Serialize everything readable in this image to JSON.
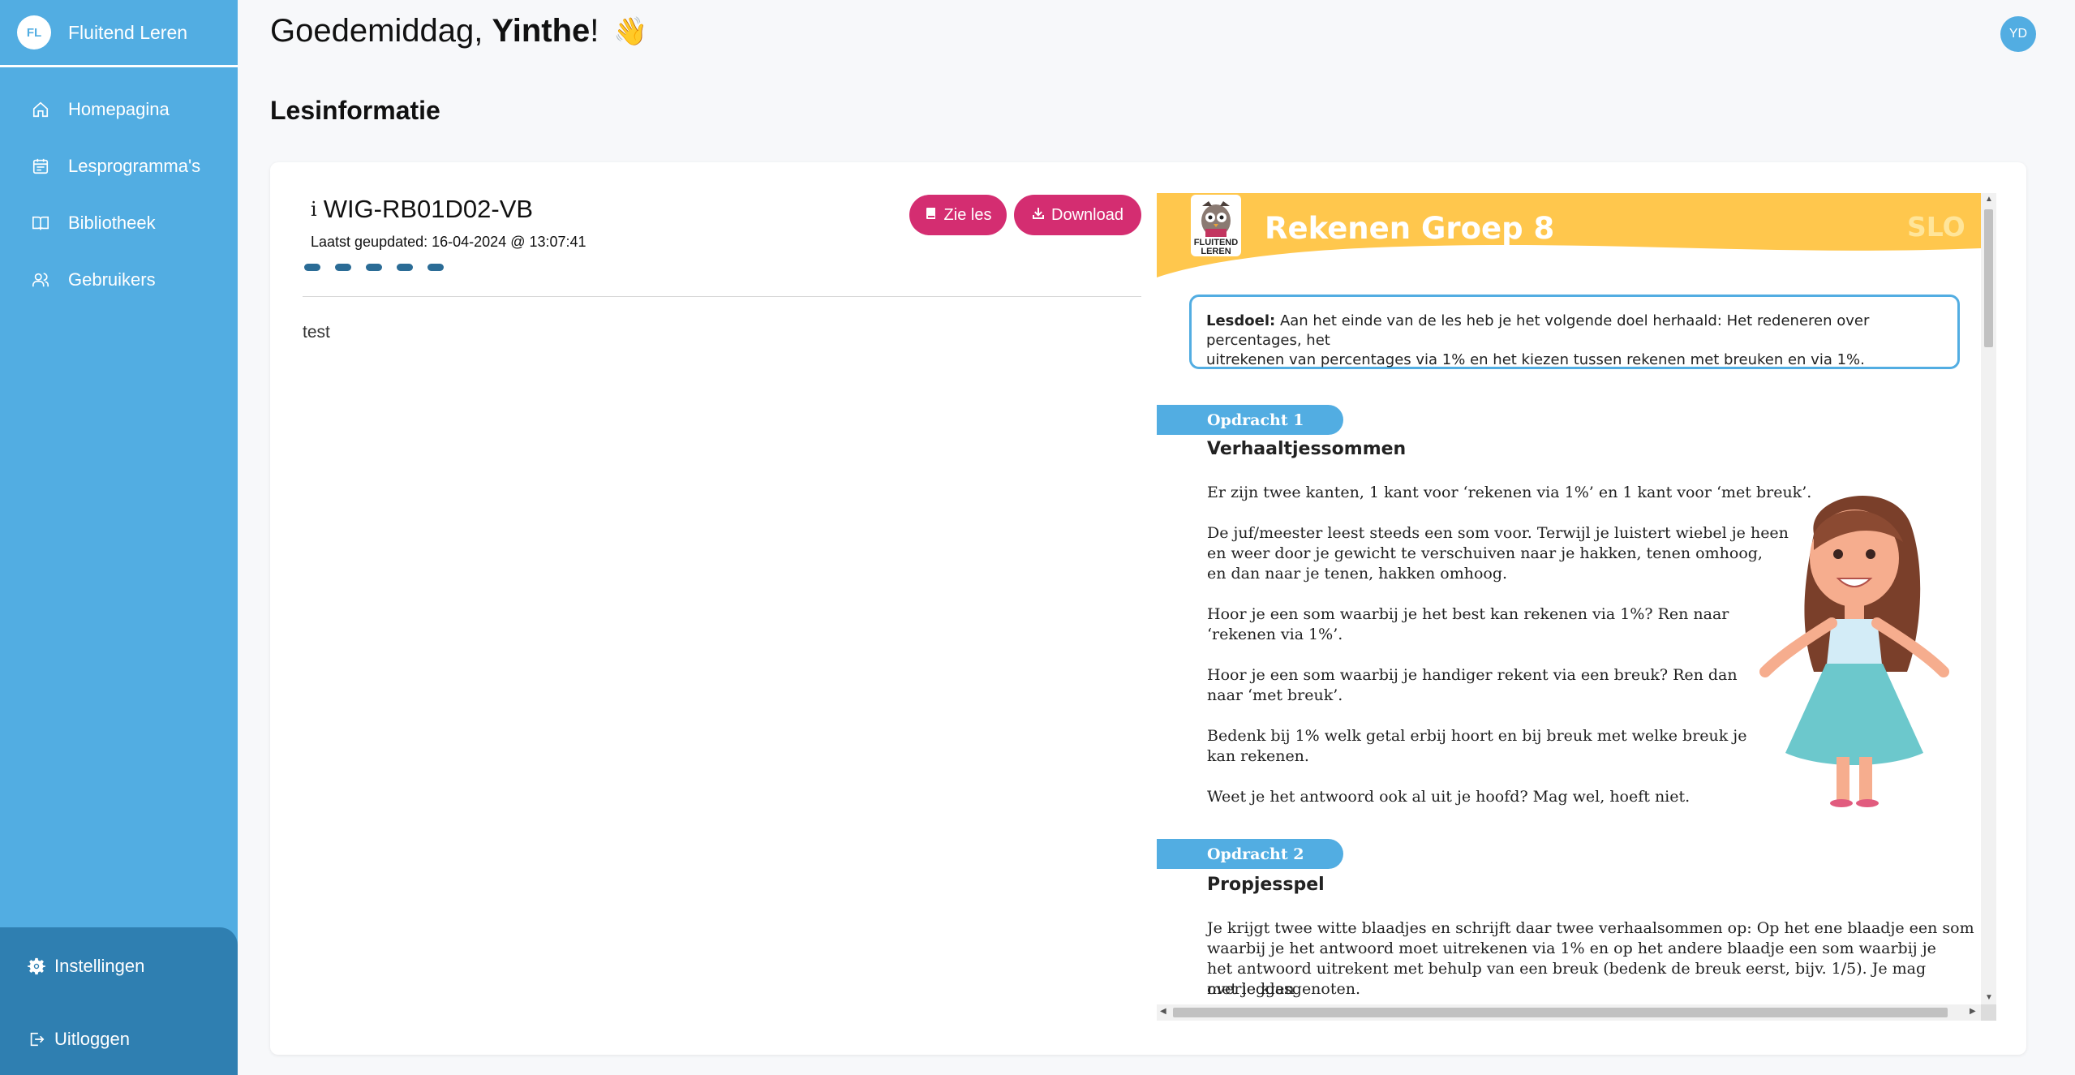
{
  "sidebar": {
    "brand_initials": "FL",
    "brand_name": "Fluitend Leren",
    "items": [
      {
        "label": "Homepagina",
        "icon": "home-icon"
      },
      {
        "label": "Lesprogramma's",
        "icon": "calendar-icon"
      },
      {
        "label": "Bibliotheek",
        "icon": "book-icon"
      },
      {
        "label": "Gebruikers",
        "icon": "users-icon"
      }
    ],
    "settings_label": "Instellingen",
    "logout_label": "Uitloggen"
  },
  "header": {
    "greeting": "Goedemiddag,",
    "name": "Yinthe",
    "punct": "!",
    "emoji": "👋",
    "user_initials": "YD"
  },
  "page_title": "Lesinformatie",
  "lesson": {
    "info_glyph": "i",
    "code": "WIG-RB01D02-VB",
    "updated": "Laatst geupdated: 16-04-2024 @ 13:07:41",
    "view_label": "Zie les",
    "download_label": "Download",
    "description": "test"
  },
  "document": {
    "subject": "Rekenen   Groep 8",
    "slo": "SLO",
    "logo_line1": "FLUITEND",
    "logo_line2": "LEREN",
    "goal_label": "Lesdoel:",
    "goal_line1": "Aan het einde van de les heb je het volgende doel herhaald: Het redeneren over percentages, het",
    "goal_line2": "uitrekenen van percentages via 1% en het kiezen tussen rekenen met breuken en via 1%.",
    "assignment1": {
      "label": "Opdracht 1",
      "title": "Verhaaltjessommen",
      "p1": "Er zijn twee kanten, 1 kant voor ‘rekenen via 1%’ en 1 kant voor ‘met breuk’.",
      "p2a": "De juf/meester leest steeds een som voor. Terwijl je luistert wiebel je heen",
      "p2b": "en weer door je gewicht te verschuiven naar je hakken, tenen omhoog,",
      "p2c": "en dan naar je tenen, hakken omhoog.",
      "p3a": "Hoor je een som waarbij je het best kan rekenen via 1%? Ren naar",
      "p3b": "‘rekenen via 1%’.",
      "p4a": "Hoor je een som waarbij je handiger rekent via een breuk? Ren dan",
      "p4b": "naar ‘met breuk’.",
      "p5a": "Bedenk bij 1% welk getal erbij hoort en bij breuk met welke breuk je",
      "p5b": "kan rekenen.",
      "p6": "Weet je het antwoord ook al uit je hoofd? Mag wel, hoeft niet."
    },
    "assignment2": {
      "label": "Opdracht 2",
      "title": "Propjesspel",
      "p1a": "Je krijgt twee witte blaadjes en schrijft daar twee verhaalsommen op: Op het ene blaadje een som",
      "p1b": "waarbij je het antwoord moet uitrekenen via 1% en op het andere blaadje een som waarbij je",
      "p1c": "het antwoord uitrekent met behulp van een breuk (bedenk de breuk eerst, bijv. 1/5). Je mag overleggen",
      "p1d": "met je klasgenoten."
    }
  },
  "colors": {
    "sidebar": "#52ade2",
    "sidebar_bottom": "#2f7fb1",
    "accent_button": "#d42d71",
    "banner": "#ffc74d",
    "progress_dots": "#2b6c96"
  }
}
